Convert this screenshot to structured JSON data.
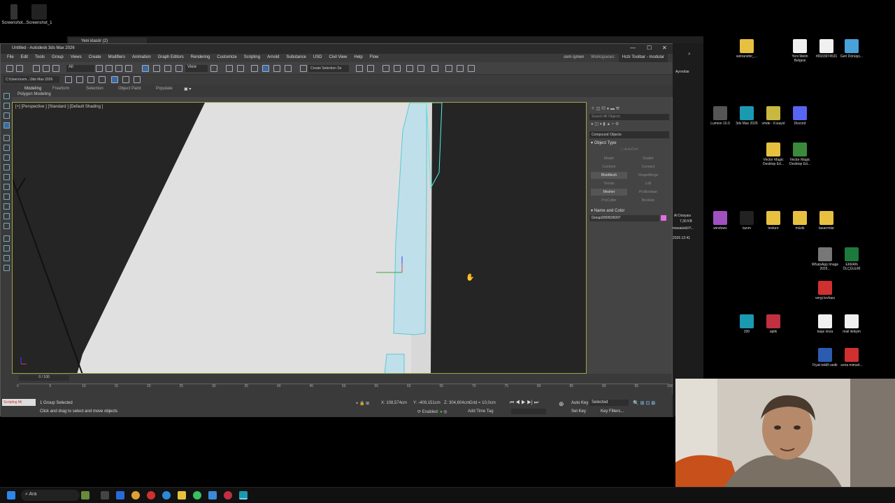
{
  "desktop_top_left": [
    {
      "label": "Screenshot..."
    },
    {
      "label": "Screenshot_1"
    }
  ],
  "explorer": {
    "tab_title": "Yeni klasör (2)"
  },
  "app": {
    "title": "Untitled - Autodesk 3ds Max 2026",
    "menus": [
      "File",
      "Edit",
      "Tools",
      "Group",
      "Views",
      "Create",
      "Modifiers",
      "Animation",
      "Graph Editors",
      "Rendering",
      "Customize",
      "Scripting",
      "Arnold",
      "Substance",
      "USD",
      "Civil View",
      "Help",
      "Flow"
    ],
    "user": "cem işmen",
    "workspaces_label": "Workspaces:",
    "workspace": "Hızlı Toolbar - modular",
    "selection_filter": "All",
    "view_dropdown": "View",
    "create_selection_set": "Create Selection Se",
    "project_path": "C:\\Users\\cem...\\3ds Max 2026",
    "ribbon_tabs": [
      "Modeling",
      "Freeform",
      "Selection",
      "Object Paint",
      "Populate"
    ],
    "ribbon_sub": "Polygon Modeling"
  },
  "viewport": {
    "label": "[+] [Perspective ] [Standard ] [Default Shading ]"
  },
  "command_panel": {
    "search_placeholder": "Search All Objects",
    "category": "Compound Objects",
    "object_type_title": "Object Type",
    "autogrid": "AutoGrid",
    "buttons": [
      {
        "label": "Morph",
        "active": false
      },
      {
        "label": "Scatter",
        "active": false
      },
      {
        "label": "Conform",
        "active": false
      },
      {
        "label": "Connect",
        "active": false
      },
      {
        "label": "BlobMesh",
        "active": true
      },
      {
        "label": "ShapeMerge",
        "active": false
      },
      {
        "label": "Terrain",
        "active": false
      },
      {
        "label": "Loft",
        "active": false
      },
      {
        "label": "Mesher",
        "active": true
      },
      {
        "label": "ProBoolean",
        "active": false
      },
      {
        "label": "ProCutter",
        "active": false
      },
      {
        "label": "Boolean",
        "active": false
      }
    ],
    "name_color_title": "Name and Color",
    "object_name": "Group2069536097",
    "swatch_color": "#e46ce0"
  },
  "timeline": {
    "frame": "0 / 100",
    "ticks": [
      "0",
      "5",
      "10",
      "15",
      "20",
      "25",
      "30",
      "35",
      "40",
      "45",
      "50",
      "55",
      "60",
      "65",
      "70",
      "75",
      "80",
      "85",
      "90",
      "95",
      "100"
    ]
  },
  "status": {
    "script_box": "Scripting Mi",
    "selected": "1 Group Selected",
    "prompt": "Click and drag to select and move objects",
    "x": "108,574cm",
    "y": "-409,151cm",
    "z": "304,604cm",
    "grid": "Grid = 10,0cm",
    "enabled": "Enabled:",
    "add_time_tag": "Add Time Tag",
    "auto_key": "Auto Key",
    "selected_dropdown": "Selected",
    "set_key": "Set Key",
    "key_filters": "Key Filters..."
  },
  "file_panel": {
    "details": "Ayrıntılar",
    "file_type": "AI Dosyası",
    "size": "7,30 KB",
    "location": "masaüstü\\Y...",
    "date": "2026 12:41"
  },
  "desktop_right": [
    {
      "label": "wetransfer_...",
      "color": "#e8c040"
    },
    {
      "label": "Yeni Metin Belgesi",
      "color": "#f0f0f0"
    },
    {
      "label": "#6933974531",
      "color": "#f0f0f0"
    },
    {
      "label": "Geri Dönüşü...",
      "color": "#4aa0d8"
    },
    {
      "label": "Lumion 10.0",
      "color": "#555"
    },
    {
      "label": "3ds Max 2026",
      "color": "#1a9ab0"
    },
    {
      "label": "vmde - Kısayol",
      "color": "#c8b840"
    },
    {
      "label": "Discord",
      "color": "#5865f2"
    },
    {
      "label": "Vector Magic Desktop Ed...",
      "color": "#e8c040"
    },
    {
      "label": "Vector Magic Desktop Ed...",
      "color": "#3a8a3a"
    },
    {
      "label": "windows",
      "color": "#a050c0"
    },
    {
      "label": "lazım",
      "color": "#222"
    },
    {
      "label": "texture",
      "color": "#e8c040"
    },
    {
      "label": "müzik",
      "color": "#e8c040"
    },
    {
      "label": "tasarımlar",
      "color": "#e8c040"
    },
    {
      "label": "WhatsApp Image 2025...",
      "color": "#777"
    },
    {
      "label": "EKRAN ÖLÇÜLERİ",
      "color": "#1d7a3d"
    },
    {
      "label": "vergi levhası",
      "color": "#d03030"
    },
    {
      "label": "200",
      "color": "#1a9ab0"
    },
    {
      "label": "aplik",
      "color": "#c03040"
    },
    {
      "label": "kaşe imza",
      "color": "#f0f0f0"
    },
    {
      "label": "mail iletişim",
      "color": "#f0f0f0"
    },
    {
      "label": "Fiyat teklifi sedir",
      "color": "#2b5cb0"
    },
    {
      "label": "sona mimarl...",
      "color": "#d03030"
    }
  ],
  "taskbar": {
    "search_label": "Ara"
  }
}
